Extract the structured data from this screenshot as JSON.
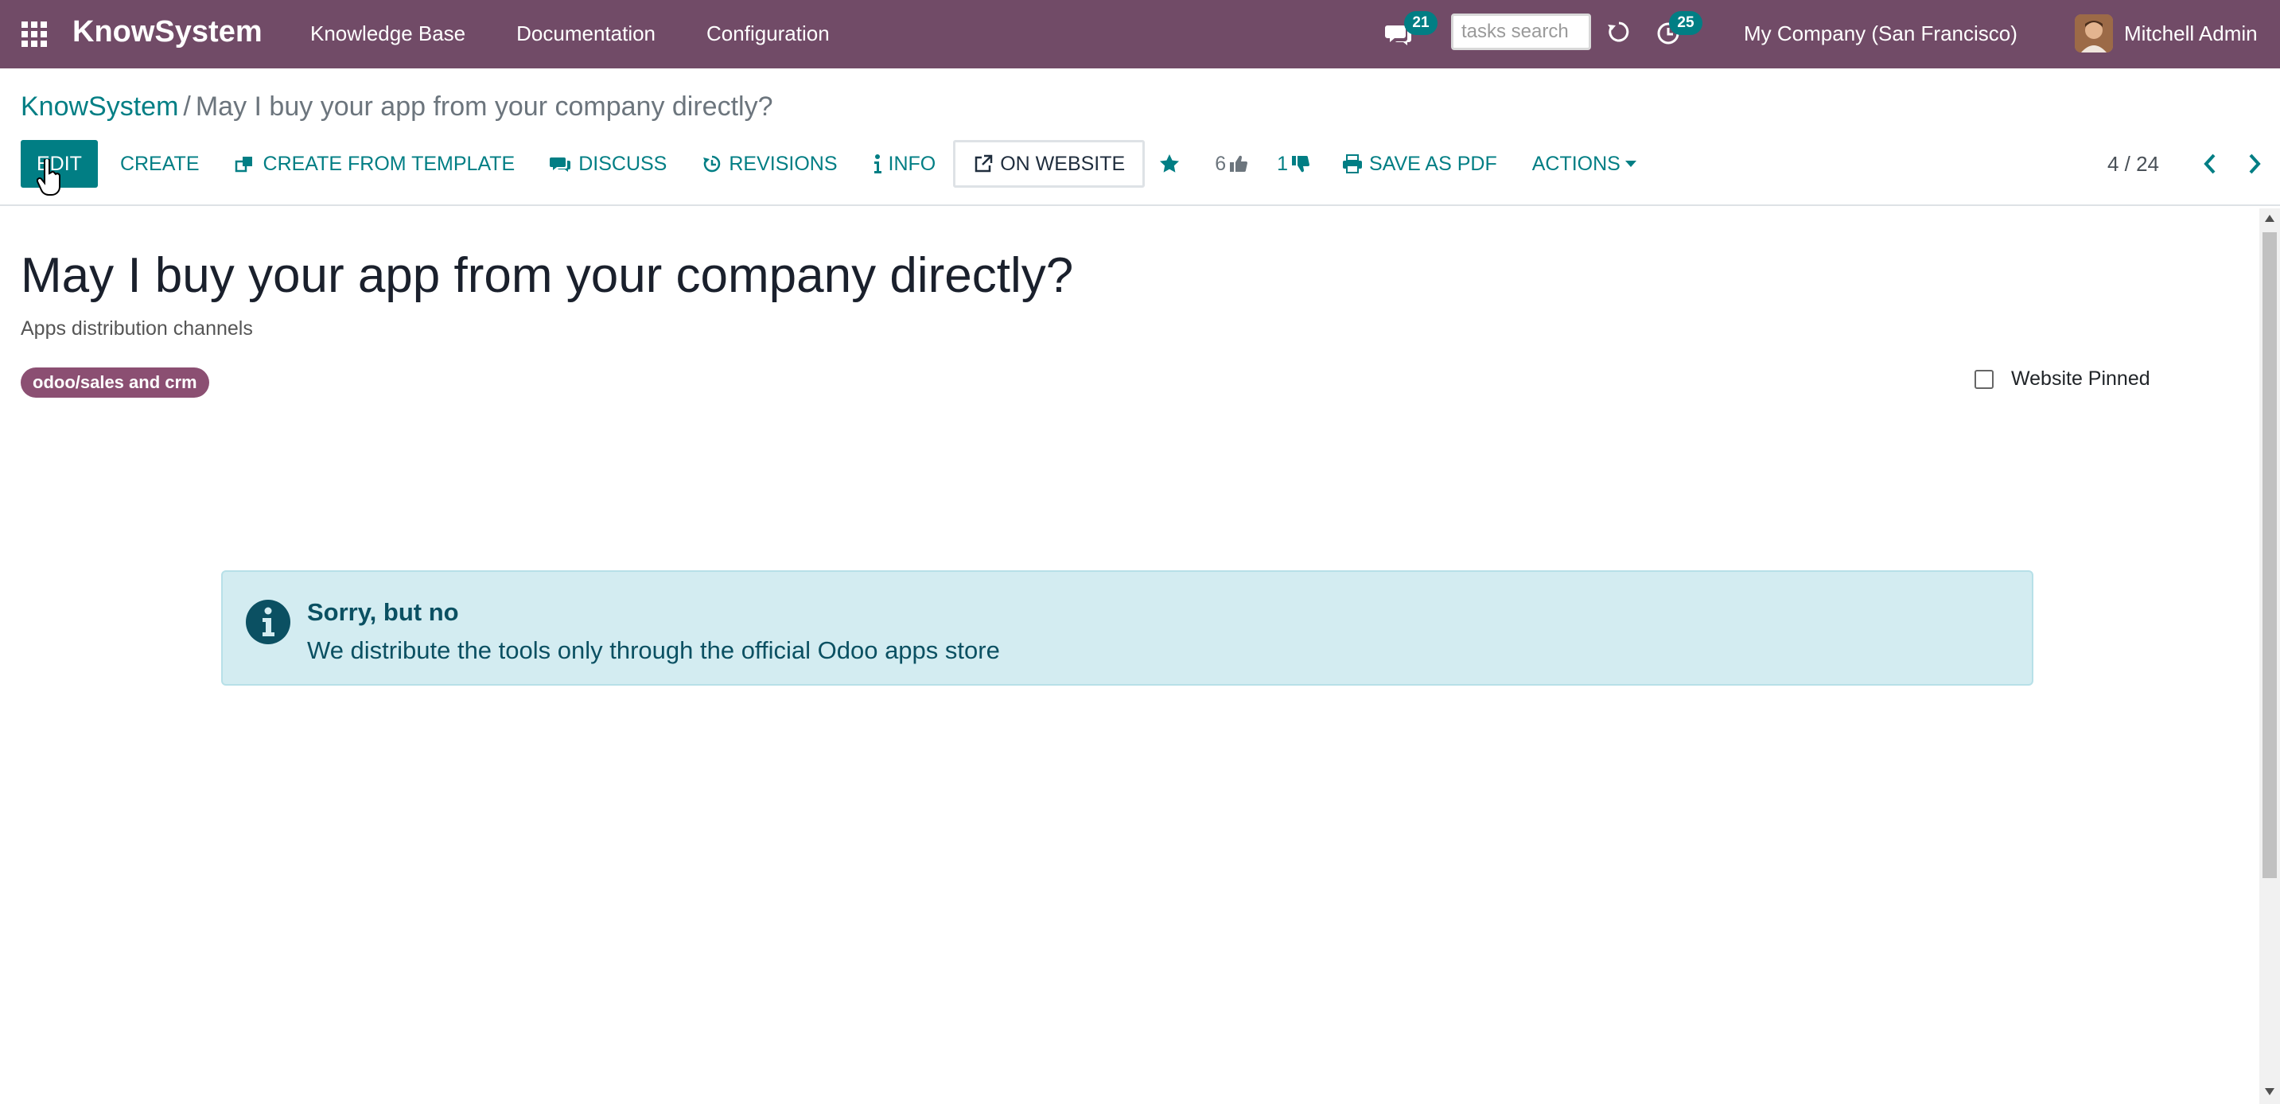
{
  "navbar": {
    "brand": "KnowSystem",
    "menu": [
      "Knowledge Base",
      "Documentation",
      "Configuration"
    ],
    "messages_count": "21",
    "activities_count": "25",
    "search_placeholder": "tasks search",
    "company": "My Company (San Francisco)",
    "user": "Mitchell Admin"
  },
  "breadcrumb": {
    "root": "KnowSystem",
    "separator": "/",
    "current": "May I buy your app from your company directly?"
  },
  "toolbar": {
    "edit": "EDIT",
    "create": "CREATE",
    "create_template": "CREATE FROM TEMPLATE",
    "discuss": "DISCUSS",
    "revisions": "REVISIONS",
    "info": "INFO",
    "on_website": "ON WEBSITE",
    "likes": "6",
    "dislikes": "1",
    "save_pdf": "SAVE AS PDF",
    "actions": "ACTIONS"
  },
  "pager": {
    "value": "4 / 24"
  },
  "article": {
    "title": "May I buy your app from your company directly?",
    "subtitle": "Apps distribution channels",
    "tag": "odoo/sales and crm",
    "website_pinned_label": "Website Pinned",
    "alert_title": "Sorry, but no",
    "alert_text": "We distribute the tools only through the official Odoo apps store"
  },
  "colors": {
    "navbar": "#714b67",
    "accent": "#017e84",
    "tag": "#8b4f72",
    "alert_bg": "#d3ecf1",
    "alert_text": "#0b5062"
  },
  "icons": [
    "apps-grid-icon",
    "chat-icon",
    "sync-icon",
    "clock-icon",
    "clone-icon",
    "comments-icon",
    "history-icon",
    "info-icon",
    "external-link-icon",
    "star-icon",
    "thumbs-up-icon",
    "thumbs-down-icon",
    "print-icon",
    "chevron-left-icon",
    "chevron-right-icon",
    "info-circle-icon"
  ]
}
